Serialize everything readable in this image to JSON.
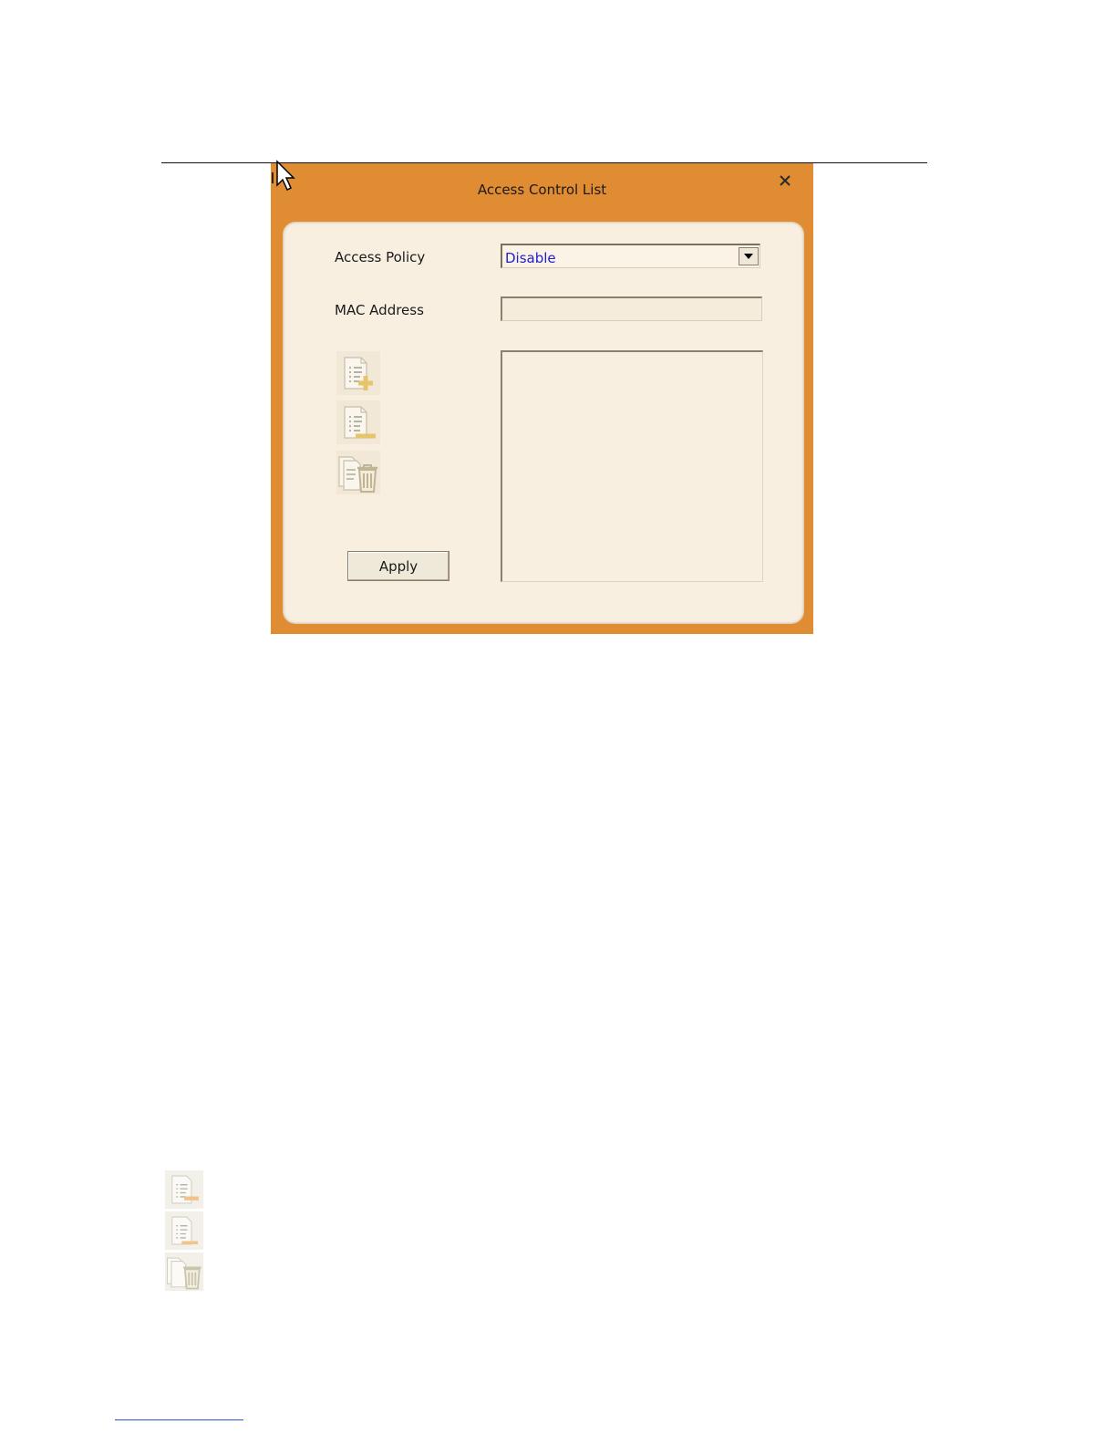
{
  "dialog": {
    "title": "Access Control List",
    "close_icon": "close-icon"
  },
  "form": {
    "access_policy_label": "Access Policy",
    "access_policy_value": "Disable",
    "mac_address_label": "MAC Address",
    "mac_address_value": ""
  },
  "toolbar": {
    "icons": [
      "add-entry-icon",
      "edit-entry-icon",
      "delete-all-icon"
    ]
  },
  "buttons": {
    "apply_label": "Apply"
  },
  "colors": {
    "title_bar": "#e08c32",
    "panel": "#f8efe1",
    "select_text": "#2020d0"
  }
}
